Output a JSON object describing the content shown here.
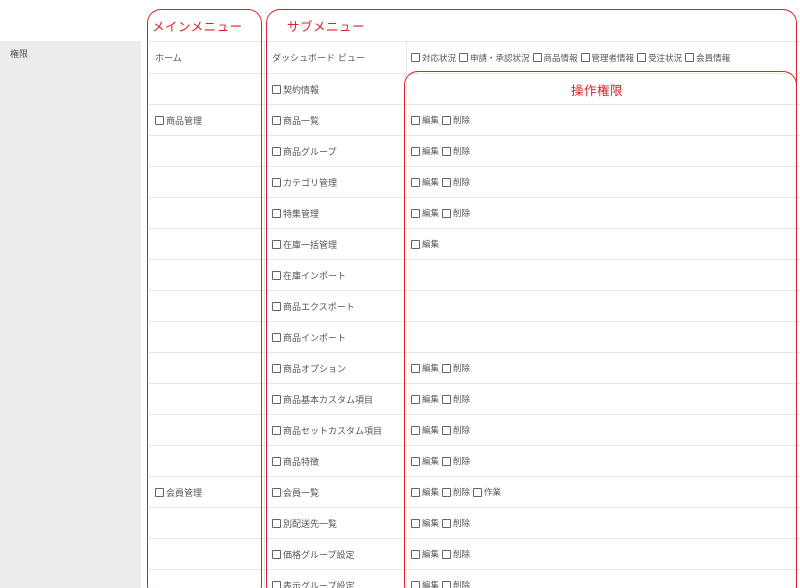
{
  "page": {
    "section_label": "権限"
  },
  "annotations": {
    "main_menu": "メインメニュー",
    "sub_menu": "サブメニュー",
    "operation": "操作権限",
    "color": "#d8232a"
  },
  "rows": [
    {
      "main": "ホーム",
      "main_checkbox": false,
      "sub": "ダッシュボード ビュー",
      "sub_checkbox": false,
      "perms": [
        "対応状況",
        "申請・承認状況",
        "商品情報",
        "管理者情報",
        "受注状況",
        "会員情報"
      ]
    },
    {
      "main": "",
      "main_checkbox": false,
      "sub": "契約情報",
      "sub_checkbox": true,
      "perms": []
    },
    {
      "main": "商品管理",
      "main_checkbox": true,
      "sub": "商品一覧",
      "sub_checkbox": true,
      "perms": [
        "編集",
        "削除"
      ]
    },
    {
      "main": "",
      "main_checkbox": false,
      "sub": "商品グループ",
      "sub_checkbox": true,
      "perms": [
        "編集",
        "削除"
      ]
    },
    {
      "main": "",
      "main_checkbox": false,
      "sub": "カテゴリ管理",
      "sub_checkbox": true,
      "perms": [
        "編集",
        "削除"
      ]
    },
    {
      "main": "",
      "main_checkbox": false,
      "sub": "特集管理",
      "sub_checkbox": true,
      "perms": [
        "編集",
        "削除"
      ]
    },
    {
      "main": "",
      "main_checkbox": false,
      "sub": "在庫一括管理",
      "sub_checkbox": true,
      "perms": [
        "編集"
      ]
    },
    {
      "main": "",
      "main_checkbox": false,
      "sub": "在庫インポート",
      "sub_checkbox": true,
      "perms": []
    },
    {
      "main": "",
      "main_checkbox": false,
      "sub": "商品エクスポート",
      "sub_checkbox": true,
      "perms": []
    },
    {
      "main": "",
      "main_checkbox": false,
      "sub": "商品インポート",
      "sub_checkbox": true,
      "perms": []
    },
    {
      "main": "",
      "main_checkbox": false,
      "sub": "商品オプション",
      "sub_checkbox": true,
      "perms": [
        "編集",
        "削除"
      ]
    },
    {
      "main": "",
      "main_checkbox": false,
      "sub": "商品基本カスタム項目",
      "sub_checkbox": true,
      "perms": [
        "編集",
        "削除"
      ]
    },
    {
      "main": "",
      "main_checkbox": false,
      "sub": "商品セットカスタム項目",
      "sub_checkbox": true,
      "perms": [
        "編集",
        "削除"
      ]
    },
    {
      "main": "",
      "main_checkbox": false,
      "sub": "商品特徴",
      "sub_checkbox": true,
      "perms": [
        "編集",
        "削除"
      ]
    },
    {
      "main": "会員管理",
      "main_checkbox": true,
      "sub": "会員一覧",
      "sub_checkbox": true,
      "perms": [
        "編集",
        "削除",
        "作業"
      ]
    },
    {
      "main": "",
      "main_checkbox": false,
      "sub": "別配送先一覧",
      "sub_checkbox": true,
      "perms": [
        "編集",
        "削除"
      ]
    },
    {
      "main": "",
      "main_checkbox": false,
      "sub": "価格グループ設定",
      "sub_checkbox": true,
      "perms": [
        "編集",
        "削除"
      ]
    },
    {
      "main": "",
      "main_checkbox": false,
      "sub": "表示グループ設定",
      "sub_checkbox": true,
      "perms": [
        "編集",
        "削除"
      ]
    }
  ]
}
